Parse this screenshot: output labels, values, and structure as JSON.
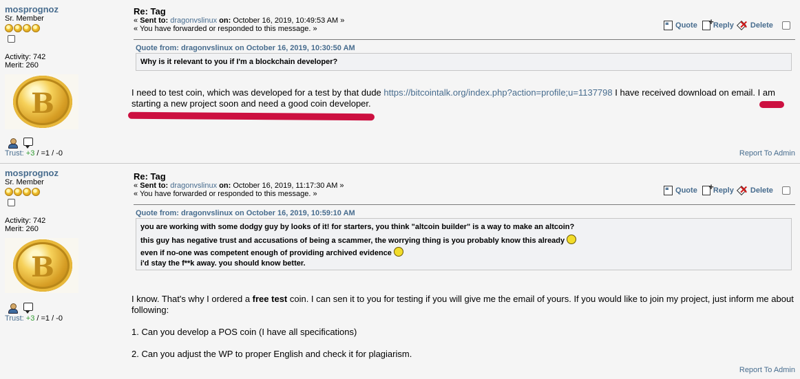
{
  "common": {
    "username": "mosprognoz",
    "rank": "Sr. Member",
    "activity": "Activity: 742",
    "merit": "Merit: 260",
    "trust_label": "Trust:",
    "trust_pos": "+3",
    "trust_rest": " / =1 / -0",
    "quote_label": "Quote",
    "reply_label": "Reply",
    "delete_label": "Delete",
    "report_label": "Report To Admin",
    "forwarded": "« You have forwarded or responded to this message. »",
    "sent_to_label": "Sent to:",
    "recipient": "dragonvslinux",
    "on_label": "on:",
    "avatar_glyph": "B",
    "icons": [
      "profile-icon",
      "pm-icon",
      "quote-icon",
      "reply-icon",
      "delete-icon"
    ],
    "accent_color": "#476c8e",
    "redaction_color": "#cc1040"
  },
  "posts": [
    {
      "subject": "Re: Tag",
      "date": "October 16, 2019, 10:49:53 AM »",
      "quote_header": "Quote from: dragonvslinux on October 16, 2019, 10:30:50 AM",
      "quote_lines": [
        "Why is it relevant to you if I'm a blockchain developer?"
      ],
      "body_before_link": "I need to test coin, which was developed for a test by that dude ",
      "link": "https://bitcointalk.org/index.php?action=profile;u=1137798",
      "body_after_link": " I have received  download on email.  I am starting a new project soon and need a good coin developer."
    },
    {
      "subject": "Re: Tag",
      "date": "October 16, 2019, 11:17:30 AM »",
      "quote_header": "Quote from: dragonvslinux on October 16, 2019, 10:59:10 AM",
      "quote_lines": [
        "you are working with some dodgy guy by looks of it! for starters, you think \"altcoin builder\" is a way to make an altcoin?",
        "this guy has negative trust and accusations of being a scammer, the worrying thing is you probably know this already",
        "even if no-one was competent enough of providing archived evidence",
        "i'd stay the f**k away. you should know better."
      ],
      "body_p1_before": "I know. That's why I ordered a ",
      "body_p1_bold": "free test",
      "body_p1_after": " coin. I can sen it to you for testing if you will give me the email of yours. If you would like to join my project, just inform me about following:",
      "body_p2": "1. Can you develop a POS coin (I have all specifications)",
      "body_p3": "2. Can you adjust the WP to proper English and check it for plagiarism."
    }
  ]
}
